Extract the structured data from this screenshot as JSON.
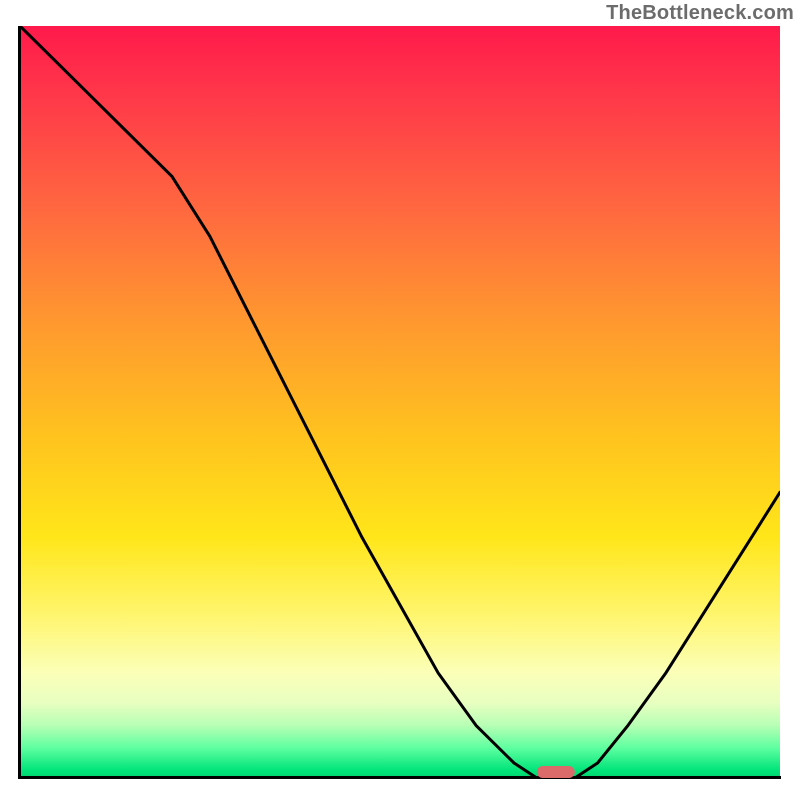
{
  "watermark": "TheBottleneck.com",
  "colors": {
    "gradient_top": "#ff1a4b",
    "gradient_mid": "#ffe61a",
    "gradient_bottom": "#00d470",
    "curve": "#000000",
    "marker": "#db6b6b",
    "axis": "#000000"
  },
  "chart_data": {
    "type": "line",
    "title": "",
    "xlabel": "",
    "ylabel": "",
    "xlim": [
      0,
      100
    ],
    "ylim": [
      0,
      100
    ],
    "x": [
      0,
      5,
      10,
      15,
      20,
      25,
      30,
      35,
      40,
      45,
      50,
      55,
      60,
      65,
      68,
      70,
      73,
      76,
      80,
      85,
      90,
      95,
      100
    ],
    "values": [
      100,
      95,
      90,
      85,
      80,
      72,
      62,
      52,
      42,
      32,
      23,
      14,
      7,
      2,
      0,
      0,
      0,
      2,
      7,
      14,
      22,
      30,
      38
    ],
    "marker": {
      "x_start": 68,
      "x_end": 73,
      "y": 0
    },
    "grid": false,
    "legend": false
  }
}
